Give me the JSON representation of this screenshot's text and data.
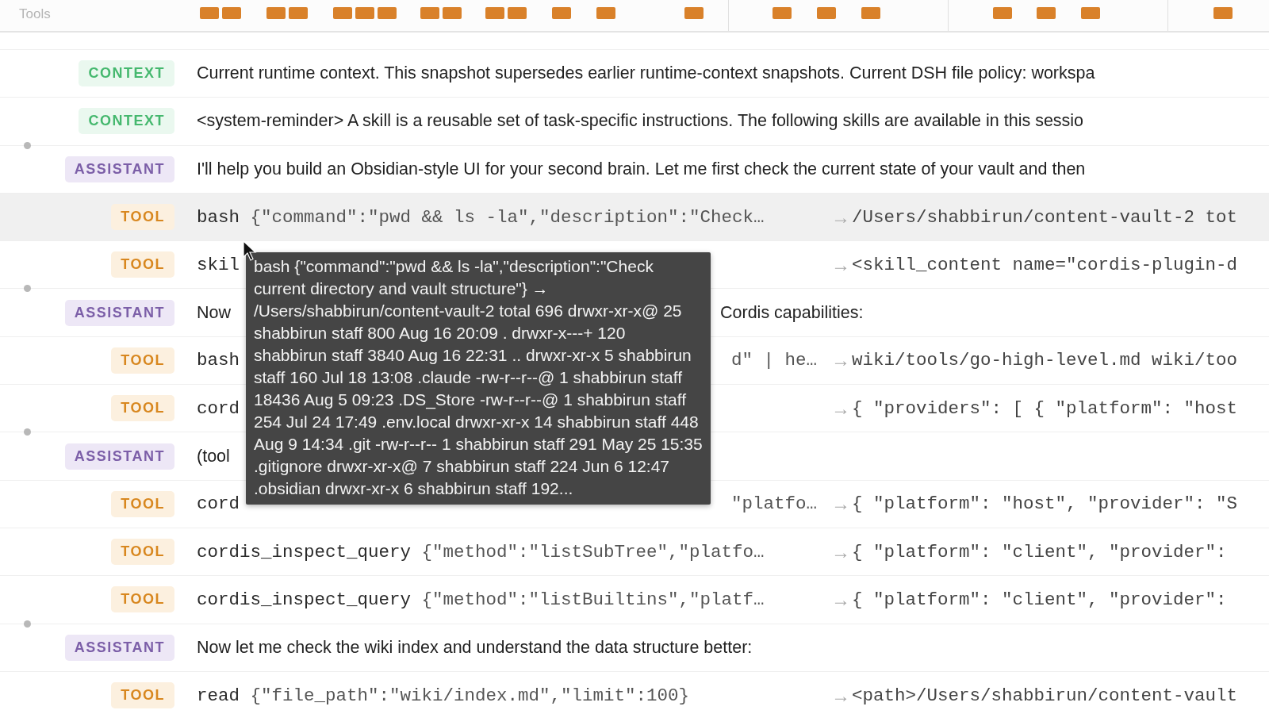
{
  "header": {
    "label": "Tools"
  },
  "rows": [
    {
      "kind": "context",
      "badge": "CONTEXT",
      "hovered": false,
      "turn_start": false,
      "text": "Current runtime context. This snapshot supersedes earlier runtime-context snapshots. Current DSH file policy: workspa"
    },
    {
      "kind": "context",
      "badge": "CONTEXT",
      "hovered": false,
      "turn_start": false,
      "text": "<system-reminder> A skill is a reusable set of task-specific instructions. The following skills are available in this sessio"
    },
    {
      "kind": "assistant",
      "badge": "ASSISTANT",
      "hovered": false,
      "turn_start": true,
      "text": "I'll help you build an Obsidian-style UI for your second brain. Let me first check the current state of your vault and then"
    },
    {
      "kind": "tool",
      "badge": "TOOL",
      "hovered": true,
      "turn_start": false,
      "tool": "bash",
      "args": "{\"command\":\"pwd && ls -la\",\"description\":\"Check…",
      "arrow": "→",
      "result": "/Users/shabbirun/content-vault-2 tot"
    },
    {
      "kind": "tool",
      "badge": "TOOL",
      "hovered": false,
      "turn_start": false,
      "tool": "skil",
      "arrow": "→",
      "result": "<skill_content name=\"cordis-plugin-d"
    },
    {
      "kind": "assistant",
      "badge": "ASSISTANT",
      "hovered": false,
      "turn_start": true,
      "text": "Now",
      "tail": "Cordis capabilities:"
    },
    {
      "kind": "tool",
      "badge": "TOOL",
      "hovered": false,
      "turn_start": false,
      "tool": "bash",
      "tail": "d\" | he…",
      "arrow": "→",
      "result": "wiki/tools/go-high-level.md wiki/too"
    },
    {
      "kind": "tool",
      "badge": "TOOL",
      "hovered": false,
      "turn_start": false,
      "tool": "cord",
      "arrow": "→",
      "result": "{ \"providers\": [ { \"platform\": \"host"
    },
    {
      "kind": "assistant",
      "badge": "ASSISTANT",
      "hovered": false,
      "turn_start": true,
      "text": "(tool"
    },
    {
      "kind": "tool",
      "badge": "TOOL",
      "hovered": false,
      "turn_start": false,
      "tool": "cord",
      "tail": "\"platfo…",
      "arrow": "→",
      "result": "{ \"platform\": \"host\", \"provider\": \"S"
    },
    {
      "kind": "tool",
      "badge": "TOOL",
      "hovered": false,
      "turn_start": false,
      "tool": "cordis_inspect_query",
      "args": "{\"method\":\"listSubTree\",\"platfo…",
      "arrow": "→",
      "result": "{ \"platform\": \"client\", \"provider\":"
    },
    {
      "kind": "tool",
      "badge": "TOOL",
      "hovered": false,
      "turn_start": false,
      "tool": "cordis_inspect_query",
      "args": "{\"method\":\"listBuiltins\",\"platf…",
      "arrow": "→",
      "result": "{ \"platform\": \"client\", \"provider\":"
    },
    {
      "kind": "assistant",
      "badge": "ASSISTANT",
      "hovered": false,
      "turn_start": true,
      "text": "Now let me check the wiki index and understand the data structure better:"
    },
    {
      "kind": "tool",
      "badge": "TOOL",
      "hovered": false,
      "turn_start": false,
      "tool": "read",
      "args": "{\"file_path\":\"wiki/index.md\",\"limit\":100}",
      "arrow": "→",
      "result": "<path>/Users/shabbirun/content-vault"
    }
  ],
  "tooltip": {
    "text": "bash {\"command\":\"pwd && ls -la\",\"description\":\"Check current directory and vault structure\"} → /Users/shabbirun/content-vault-2 total 696 drwxr-xr-x@ 25 shabbirun staff 800 Aug 16 20:09 . drwxr-x---+ 120 shabbirun staff 3840 Aug 16 22:31 .. drwxr-xr-x 5 shabbirun staff 160 Jul 18 13:08 .claude -rw-r--r--@ 1 shabbirun staff 18436 Aug 5 09:23 .DS_Store -rw-r--r--@ 1 shabbirun staff 254 Jul 24 17:49 .env.local drwxr-xr-x 14 shabbirun staff 448 Aug 9 14:34 .git -rw-r--r-- 1 shabbirun staff 291 May 25 15:35 .gitignore drwxr-xr-x@ 7 shabbirun staff 224 Jun 6 12:47 .obsidian drwxr-xr-x 6 shabbirun staff 192..."
  }
}
